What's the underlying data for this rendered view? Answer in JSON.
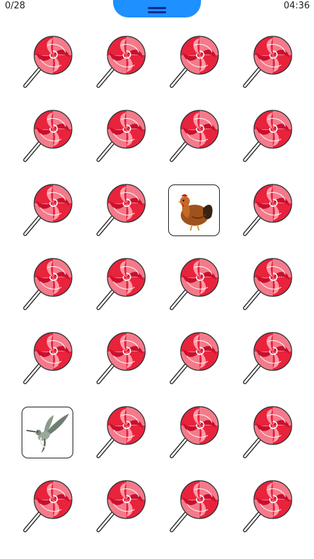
{
  "status": {
    "score": "0/28",
    "time": "04:36"
  },
  "menu": {
    "icon": "hamburger-icon",
    "color": "#1e90ff"
  },
  "board": {
    "columns": 4,
    "rows": 7,
    "card_back_icon": "lollipop-icon",
    "revealed": [
      {
        "index": 10,
        "animal": "hen"
      },
      {
        "index": 20,
        "animal": "hummingbird"
      }
    ]
  },
  "colors": {
    "lollipop_red": "#e8233c",
    "lollipop_light": "#f47a8a",
    "menu_blue": "#1e90ff"
  }
}
